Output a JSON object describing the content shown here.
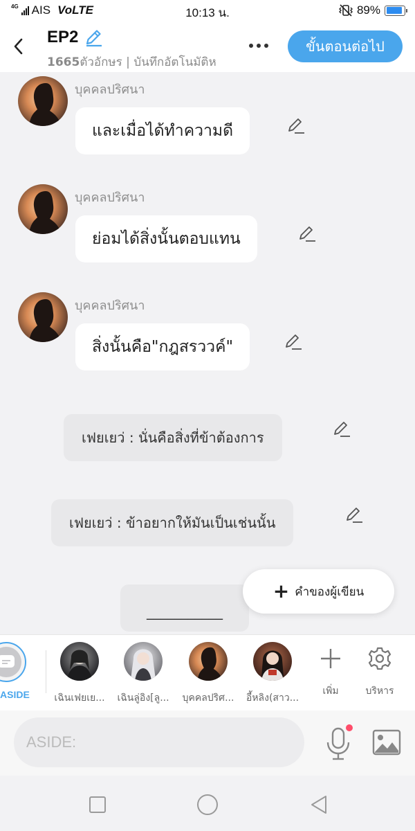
{
  "status_bar": {
    "network_type": "4G",
    "carrier": "AIS",
    "volte": "VoLTE",
    "time": "10:13 น.",
    "battery_percent": "89%",
    "battery_level": 0.89
  },
  "header": {
    "title": "EP2",
    "char_count": "1665",
    "subtitle_rest": "ตัวอักษร | บันทึกอัตโนมัติห",
    "next_button": "ขั้นตอนต่อไป"
  },
  "messages": [
    {
      "speaker": "บุคคลปริศนา",
      "text": "และเมื่อได้ทำความดี"
    },
    {
      "speaker": "บุคคลปริศนา",
      "text": "ย่อมได้สิ่งนั้นตอบแทน"
    },
    {
      "speaker": "บุคคลปริศนา",
      "text": "สิ่งนั้นคือ\"กฎสรววค์\""
    }
  ],
  "asides": [
    {
      "text": "เฟยเยว่ : นั่นคือสิ่งที่ข้าต้องการ"
    },
    {
      "text": "เฟยเยว่ : ข้าอยากให้มันเป็นเช่นนั้น"
    }
  ],
  "blank_line": "___________",
  "author_note_button": "คำของผู้เขียน",
  "characters": {
    "aside_label": "ASIDE",
    "items": [
      {
        "name": "เฉินเฟยเย..."
      },
      {
        "name": "เฉินลู่อิง[ลู..."
      },
      {
        "name": "บุคคลปริศ..."
      },
      {
        "name": "อี้หลิง(สาว..."
      }
    ],
    "add_label": "เพิ่ม",
    "manage_label": "บริหาร"
  },
  "input": {
    "placeholder": "ASIDE:"
  },
  "colors": {
    "accent": "#4aa6ec",
    "notification_dot": "#ff4d6a"
  }
}
